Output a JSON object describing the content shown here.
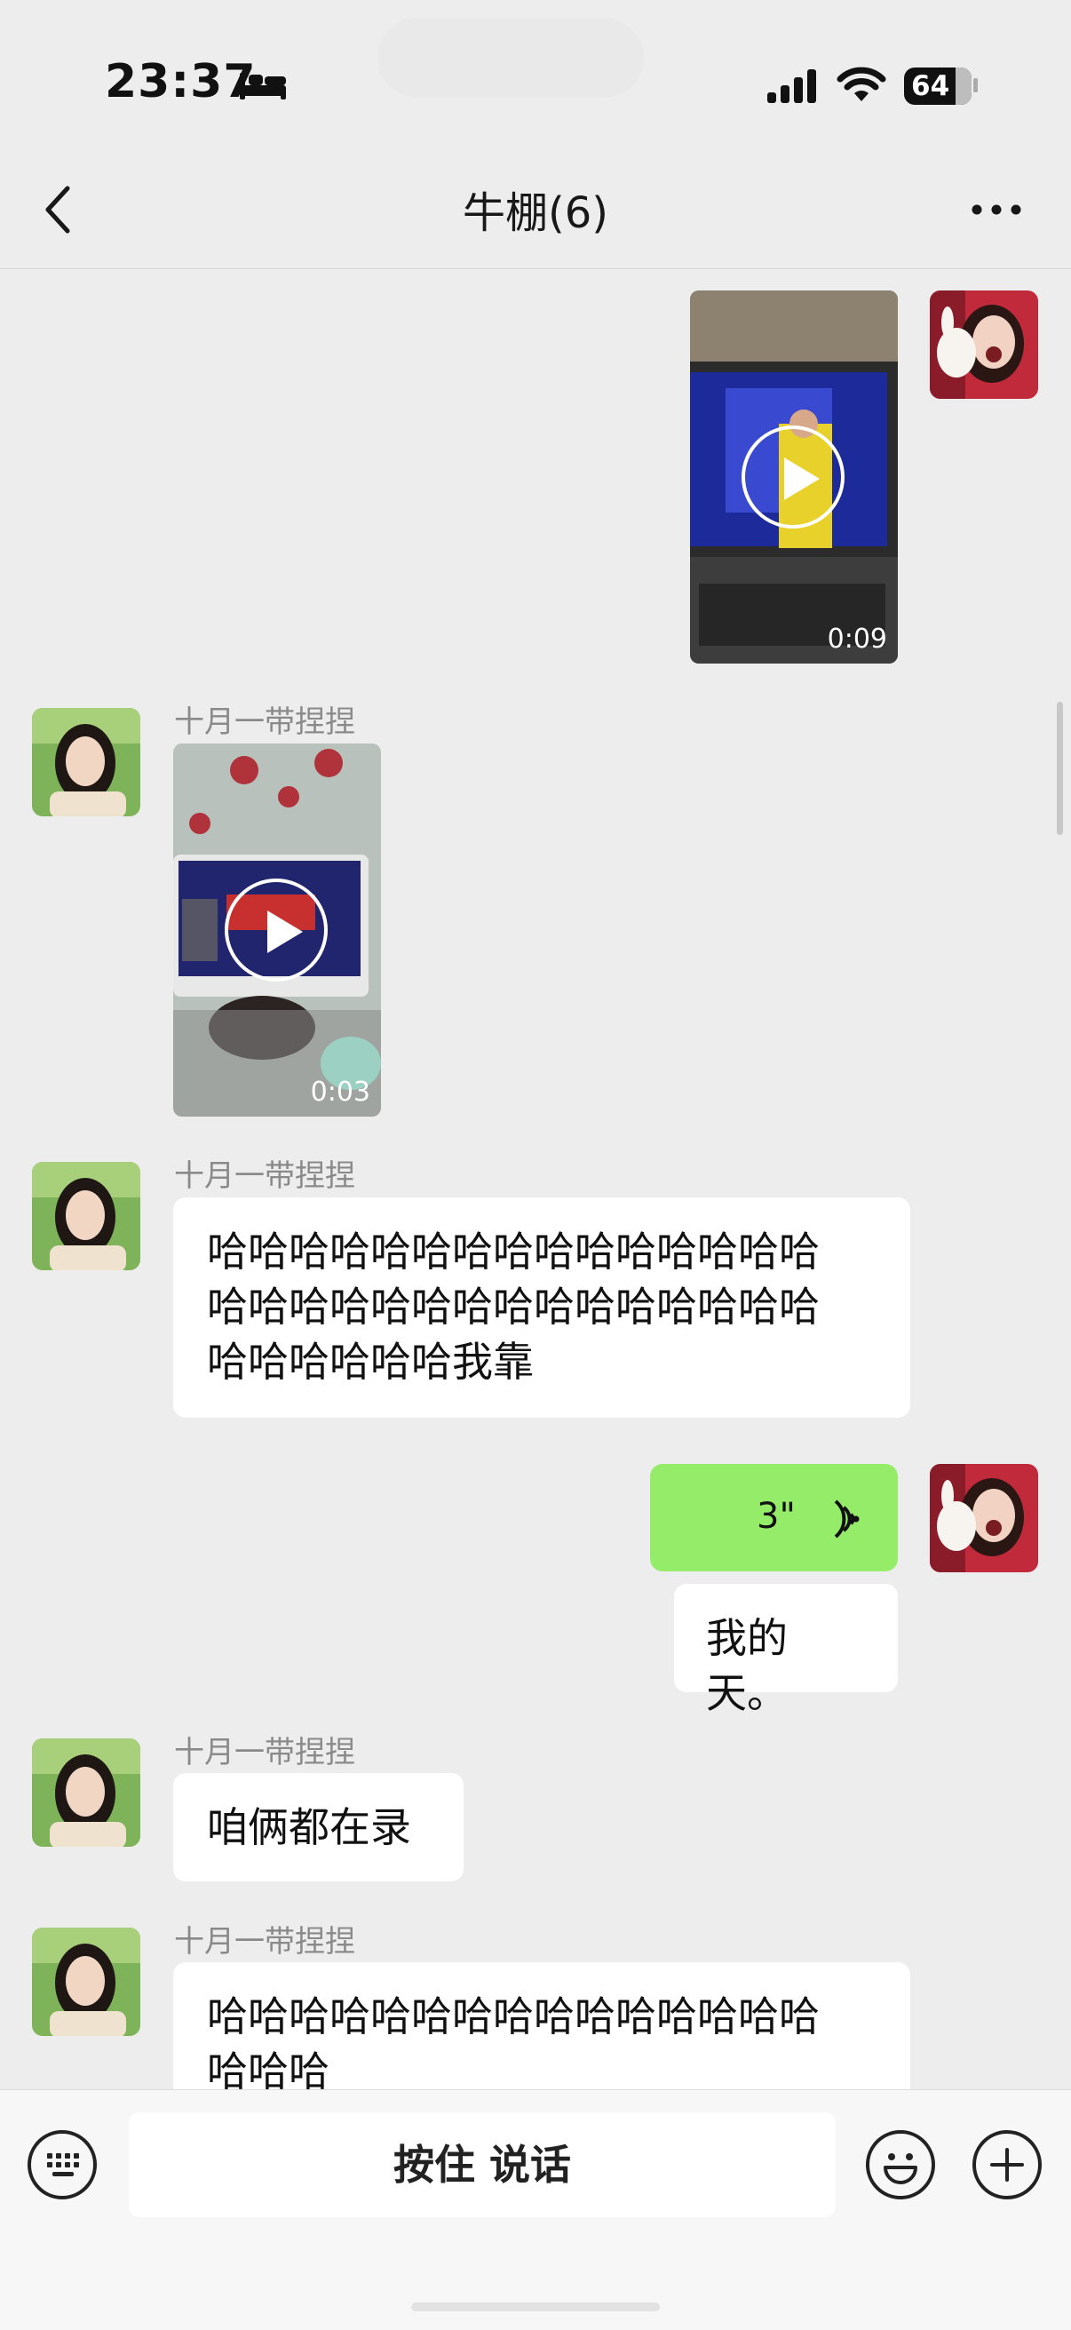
{
  "status_bar": {
    "time": "23:37",
    "battery": "64"
  },
  "nav": {
    "title": "牛棚(6)"
  },
  "messages": [
    {
      "side": "right",
      "type": "video",
      "duration": "0:09"
    },
    {
      "side": "left",
      "type": "video",
      "sender": "十月一带捏捏",
      "duration": "0:03"
    },
    {
      "side": "left",
      "type": "text",
      "sender": "十月一带捏捏",
      "lines": [
        "哈哈哈哈哈哈哈哈哈哈哈哈哈哈哈",
        "哈哈哈哈哈哈哈哈哈哈哈哈哈哈哈",
        "哈哈哈哈哈哈我靠"
      ]
    },
    {
      "side": "right",
      "type": "voice",
      "duration": "3\""
    },
    {
      "side": "right",
      "type": "text",
      "text": "我的天。"
    },
    {
      "side": "left",
      "type": "text",
      "sender": "十月一带捏捏",
      "text": "咱俩都在录"
    },
    {
      "side": "left",
      "type": "text",
      "sender": "十月一带捏捏",
      "lines": [
        "哈哈哈哈哈哈哈哈哈哈哈哈哈哈哈",
        "哈哈哈"
      ]
    }
  ],
  "input": {
    "hold_to_talk": "按住 说话"
  },
  "icons": {
    "back": "chevron-left-icon",
    "more": "more-dots-icon",
    "keyboard": "keyboard-icon",
    "emoji": "emoji-icon",
    "plus": "plus-icon",
    "play": "play-icon",
    "voice": "voice-wave-icon"
  },
  "colors": {
    "background": "#ededed",
    "bubble_self": "#95ec69",
    "bubble_other": "#ffffff"
  }
}
